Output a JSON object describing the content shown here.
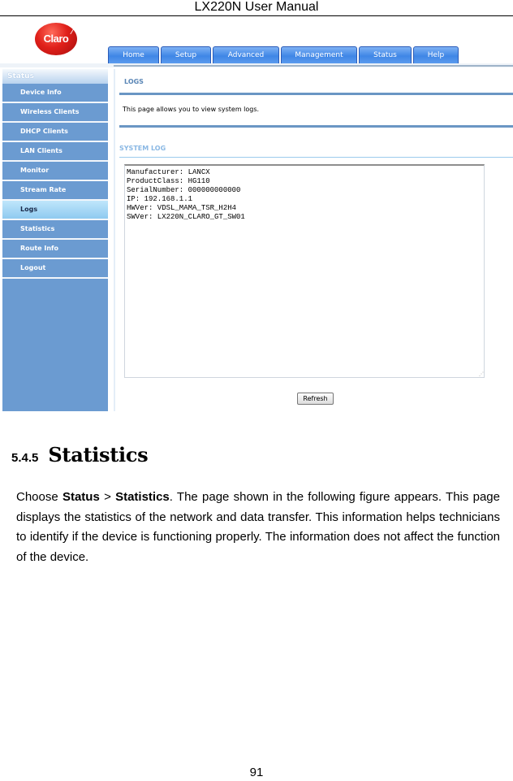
{
  "document": {
    "running_header": "LX220N User Manual",
    "page_number": "91"
  },
  "router_ui": {
    "logo_text": "Claro",
    "nav_tabs": [
      {
        "label": "Home"
      },
      {
        "label": "Setup"
      },
      {
        "label": "Advanced"
      },
      {
        "label": "Management"
      },
      {
        "label": "Status"
      },
      {
        "label": "Help"
      }
    ],
    "sidebar": {
      "heading": "Status",
      "items": [
        {
          "label": "Device Info",
          "active": false
        },
        {
          "label": "Wireless Clients",
          "active": false
        },
        {
          "label": "DHCP Clients",
          "active": false
        },
        {
          "label": "LAN Clients",
          "active": false
        },
        {
          "label": "Monitor",
          "active": false
        },
        {
          "label": "Stream Rate",
          "active": false
        },
        {
          "label": "Logs",
          "active": true
        },
        {
          "label": "Statistics",
          "active": false
        },
        {
          "label": "Route Info",
          "active": false
        },
        {
          "label": "Logout",
          "active": false
        }
      ]
    },
    "content": {
      "title": "LOGS",
      "description": "This page allows you to view system logs.",
      "system_log_title": "SYSTEM LOG",
      "log_lines": [
        "Manufacturer: LANCX",
        "ProductClass: HG110",
        "SerialNumber: 000000000000",
        "IP: 192.168.1.1",
        "HWVer: VDSL_MAMA_TSR_H2H4",
        "SWVer: LX220N_CLARO_GT_SW01"
      ],
      "refresh_label": "Refresh"
    },
    "colors": {
      "tab_blue": "#3f86e6",
      "sidebar_blue": "#6b9bd1",
      "active_item": "#a8d8f6",
      "rule_blue": "#6a96c4",
      "logo_red": "#e0201a"
    }
  },
  "section": {
    "number": "5.4.5",
    "title": "Statistics",
    "paragraph": {
      "p1": "Choose ",
      "b1": "Status",
      "p2": " > ",
      "b2": "Statistics",
      "p3": ". The page shown in the following figure appears. This page displays the statistics of the network and data transfer. This information helps technicians to identify if the device is functioning properly. The information does not affect the function of the device."
    }
  }
}
